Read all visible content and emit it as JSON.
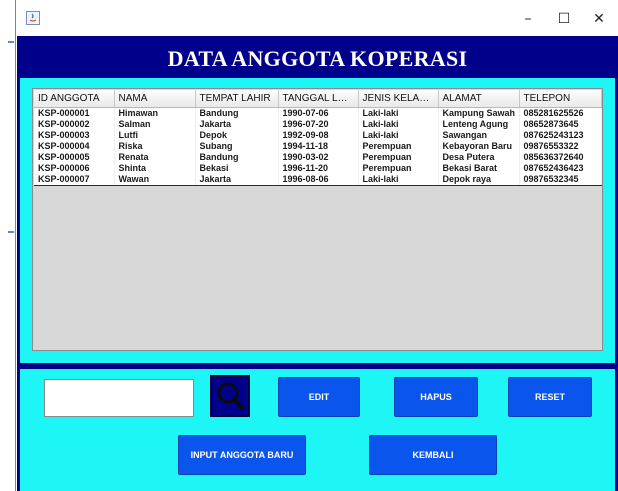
{
  "window": {
    "icon": "java-app-icon",
    "controls": {
      "minimize": "–",
      "maximize": "☐",
      "close": "✕"
    }
  },
  "header": {
    "title": "DATA ANGGOTA KOPERASI"
  },
  "table": {
    "columns": [
      "ID ANGGOTA",
      "NAMA",
      "TEMPAT LAHIR",
      "TANGGAL LAH...",
      "JENIS KELAMIN",
      "ALAMAT",
      "TELEPON"
    ],
    "rows": [
      [
        "KSP-000001",
        "Himawan",
        "Bandung",
        "1990-07-06",
        "Laki-laki",
        "Kampung Sawah",
        "085281625526"
      ],
      [
        "KSP-000002",
        "Salman",
        "Jakarta",
        "1996-07-20",
        "Laki-laki",
        "Lenteng Agung",
        "08652873645"
      ],
      [
        "KSP-000003",
        "Lutfi",
        "Depok",
        "1992-09-08",
        "Laki-laki",
        "Sawangan",
        "087625243123"
      ],
      [
        "KSP-000004",
        "Riska",
        "Subang",
        "1994-11-18",
        "Perempuan",
        "Kebayoran Baru",
        "09876553322"
      ],
      [
        "KSP-000005",
        "Renata",
        "Bandung",
        "1990-03-02",
        "Perempuan",
        "Desa Putera",
        "085636372640"
      ],
      [
        "KSP-000006",
        "Shinta",
        "Bekasi",
        "1996-11-20",
        "Perempuan",
        "Bekasi Barat",
        "087652436423"
      ],
      [
        "KSP-000007",
        "Wawan",
        "Jakarta",
        "1996-08-06",
        "Laki-laki",
        "Depok raya",
        "09876532345"
      ]
    ]
  },
  "search": {
    "value": "",
    "icon": "search-icon"
  },
  "buttons": {
    "edit": "EDIT",
    "hapus": "HAPUS",
    "reset": "RESET",
    "input_baru": "INPUT ANGGOTA BARU",
    "kembali": "KEMBALI"
  },
  "colors": {
    "header_bg": "#00008b",
    "panel_bg": "#1ef5f5",
    "button_bg": "#0a55ec",
    "table_bg": "#d8d8d8"
  }
}
